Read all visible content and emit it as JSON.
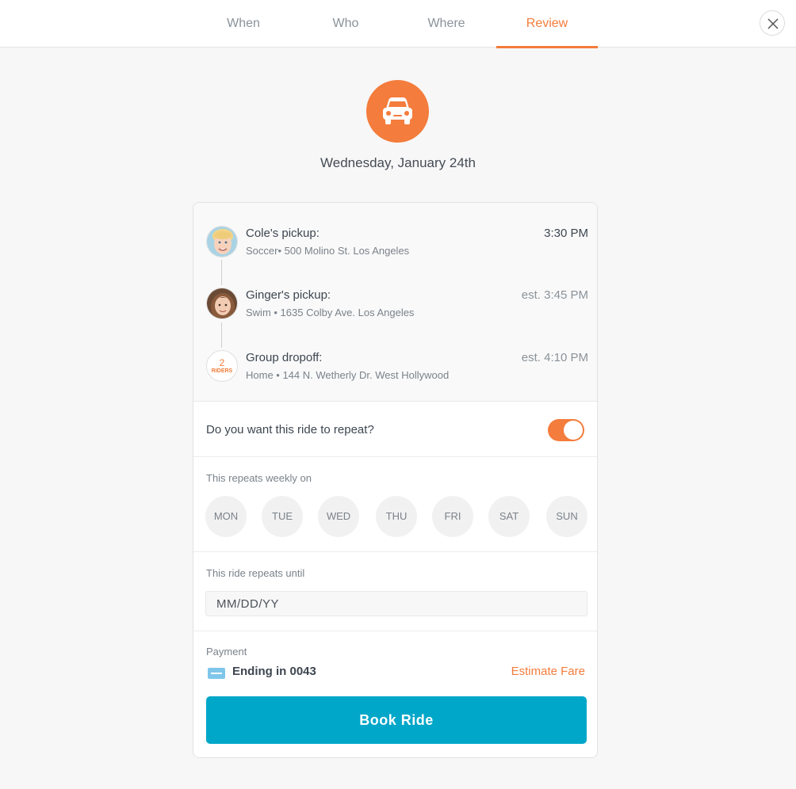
{
  "tabs": [
    {
      "label": "When",
      "active": false
    },
    {
      "label": "Who",
      "active": false
    },
    {
      "label": "Where",
      "active": false
    },
    {
      "label": "Review",
      "active": true
    }
  ],
  "header": {
    "icon": "car-icon",
    "date": "Wednesday, January 24th"
  },
  "stops": [
    {
      "title": "Cole's pickup:",
      "subtitle": "Soccer• 500 Molino St. Los Angeles",
      "time": "3:30 PM",
      "avatar": "child-boy-avatar"
    },
    {
      "title": "Ginger's pickup:",
      "subtitle": "Swim • 1635 Colby Ave.  Los Angeles",
      "time": "est. 3:45 PM",
      "avatar": "child-girl-avatar"
    },
    {
      "title": "Group dropoff:",
      "subtitle": "Home • 144 N. Wetherly Dr. West Hollywood",
      "time": "est. 4:10 PM",
      "riders_count": "2",
      "riders_label": "RIDERS"
    }
  ],
  "repeat": {
    "question": "Do you want this ride to repeat?",
    "enabled": true
  },
  "weekly": {
    "label": "This repeats weekly on",
    "days": [
      "MON",
      "TUE",
      "WED",
      "THU",
      "FRI",
      "SAT",
      "SUN"
    ]
  },
  "until": {
    "label": "This ride repeats until",
    "placeholder": "MM/DD/YY"
  },
  "payment": {
    "label": "Payment",
    "card_text": "Ending in 0043",
    "estimate_label": "Estimate Fare"
  },
  "book_label": "Book Ride",
  "colors": {
    "accent": "#f47c3c",
    "primary_button": "#00a7c8"
  }
}
